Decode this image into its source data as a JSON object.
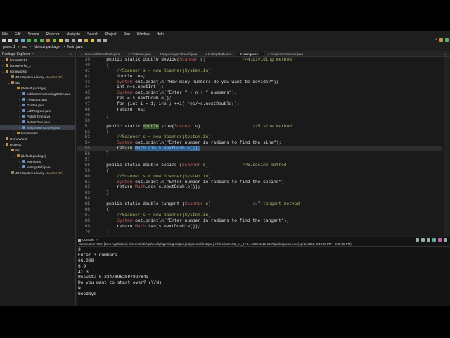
{
  "menu": [
    "File",
    "Edit",
    "Source",
    "Refactor",
    "Navigate",
    "Search",
    "Project",
    "Run",
    "Window",
    "Help"
  ],
  "breadcrumb": [
    "project1",
    "src",
    "(default package)",
    "Main.java"
  ],
  "package_explorer": {
    "title": "Package Explorer",
    "items": [
      {
        "label": "homeWork4",
        "depth": 0,
        "arrow": "›",
        "icon": "project"
      },
      {
        "label": "homeWork4_2",
        "depth": 0,
        "arrow": "›",
        "icon": "project"
      },
      {
        "label": "homework5",
        "depth": 0,
        "arrow": "⌄",
        "icon": "project"
      },
      {
        "label": "JRE System Library",
        "suffix": "[JavaSE-17]",
        "depth": 1,
        "arrow": "›",
        "icon": "library"
      },
      {
        "label": "src",
        "depth": 1,
        "arrow": "⌄",
        "icon": "folder"
      },
      {
        "label": "(default package)",
        "depth": 2,
        "arrow": "⌄",
        "icon": "package"
      },
      {
        "label": "bubleSortAscendingOrder.java",
        "depth": 3,
        "arrow": "›",
        "icon": "java"
      },
      {
        "label": "FirstLoop.java",
        "depth": 3,
        "arrow": "›",
        "icon": "java"
      },
      {
        "label": "Grades.java",
        "depth": 3,
        "arrow": "›",
        "icon": "java"
      },
      {
        "label": "LabProgram.java",
        "depth": 3,
        "arrow": "›",
        "icon": "java"
      },
      {
        "label": "PatternOne.java",
        "depth": 3,
        "arrow": "›",
        "icon": "java"
      },
      {
        "label": "PatternTwo.java",
        "depth": 3,
        "arrow": "›",
        "icon": "java"
      },
      {
        "label": "TelephoneNumber.java",
        "depth": 3,
        "arrow": "›",
        "icon": "java",
        "selected": true
      },
      {
        "label": "homework5",
        "depth": 2,
        "arrow": "›",
        "icon": "package"
      },
      {
        "label": "HomeWork6",
        "depth": 0,
        "arrow": "›",
        "icon": "project"
      },
      {
        "label": "project1",
        "depth": 0,
        "arrow": "⌄",
        "icon": "project"
      },
      {
        "label": "src",
        "depth": 1,
        "arrow": "⌄",
        "icon": "folder"
      },
      {
        "label": "(default package)",
        "depth": 2,
        "arrow": "⌄",
        "icon": "package"
      },
      {
        "label": "Main.java",
        "depth": 3,
        "arrow": "›",
        "icon": "java"
      },
      {
        "label": "testingMath.java",
        "depth": 3,
        "arrow": "›",
        "icon": "java"
      },
      {
        "label": "JRE System Library",
        "suffix": "[JavaSE-17]",
        "depth": 1,
        "arrow": "›",
        "icon": "library"
      }
    ]
  },
  "tabs": [
    {
      "label": "Homework6Methods.java"
    },
    {
      "label": "FirstLoop.java"
    },
    {
      "label": "CopenhagenTransit.java"
    },
    {
      "label": "testingMath.java"
    },
    {
      "label": "Main.java",
      "active": true
    },
    {
      "label": "TelephoneNumber.java"
    }
  ],
  "code": [
    {
      "n": "39",
      "t": [
        [
          "    public static double devide(",
          "kw"
        ],
        [
          "Scanner",
          "ty"
        ],
        [
          " s)              ",
          "kw"
        ],
        [
          "//4.dividing method",
          "cm"
        ]
      ]
    },
    {
      "n": "40",
      "t": [
        [
          "    {",
          "pl"
        ]
      ]
    },
    {
      "n": "41",
      "t": [
        [
          "        //Scanner s = new Scanner(System.in);",
          "cm"
        ]
      ]
    },
    {
      "n": "42",
      "t": [
        [
          "        double res;",
          "pl"
        ]
      ]
    },
    {
      "n": "43",
      "t": [
        [
          "        ",
          "pl"
        ],
        [
          "System",
          "ty"
        ],
        [
          ".out.println(\"How many numbers do you want to devide?\");",
          "pl"
        ]
      ]
    },
    {
      "n": "44",
      "t": [
        [
          "        int n=s.nextInt();",
          "pl"
        ]
      ]
    },
    {
      "n": "45",
      "t": [
        [
          "        ",
          "pl"
        ],
        [
          "System",
          "ty"
        ],
        [
          ".out.println(\"Enter \" + n + \" numbers\");",
          "pl"
        ]
      ]
    },
    {
      "n": "46",
      "t": [
        [
          "        res = s.nextDouble();",
          "pl"
        ]
      ]
    },
    {
      "n": "47",
      "t": [
        [
          "        for (int i = 1; i<n ; ++i) res/=s.nextDouble();",
          "pl"
        ]
      ]
    },
    {
      "n": "48",
      "t": [
        [
          "        return res;",
          "pl"
        ]
      ]
    },
    {
      "n": "49",
      "t": [
        [
          "    }",
          "pl"
        ]
      ]
    },
    {
      "n": "50",
      "t": []
    },
    {
      "n": "51",
      "t": [
        [
          "    public static ",
          "kw"
        ],
        [
          "double",
          "hl"
        ],
        [
          " sine(",
          "kw"
        ],
        [
          "Scanner",
          "ty"
        ],
        [
          " s)                    ",
          "kw"
        ],
        [
          "//5.sine method",
          "cm"
        ]
      ]
    },
    {
      "n": "52",
      "t": [
        [
          "    {",
          "pl"
        ]
      ]
    },
    {
      "n": "53",
      "t": [
        [
          "        //Scanner s = new Scanner(System.in);",
          "cm"
        ]
      ]
    },
    {
      "n": "54",
      "t": [
        [
          "        ",
          "pl"
        ],
        [
          "System",
          "ty"
        ],
        [
          ".out.println(\"Enter number in radians to find the sine\");",
          "pl"
        ]
      ]
    },
    {
      "n": "55",
      "cur": true,
      "t": [
        [
          "        return ",
          "pl"
        ],
        [
          "Math.sin(s.nextDouble());",
          "sel"
        ]
      ]
    },
    {
      "n": "56",
      "t": [
        [
          "    }",
          "pl"
        ]
      ]
    },
    {
      "n": "57",
      "t": []
    },
    {
      "n": "58",
      "t": [
        [
          "    public static double cosine (",
          "kw"
        ],
        [
          "Scanner",
          "ty"
        ],
        [
          " s)             ",
          "kw"
        ],
        [
          "//6.cosine method",
          "cm"
        ]
      ]
    },
    {
      "n": "59",
      "t": [
        [
          "    {",
          "pl"
        ]
      ]
    },
    {
      "n": "60",
      "t": [
        [
          "        //Scanner s = new Scanner(System.in);",
          "cm"
        ]
      ]
    },
    {
      "n": "61",
      "t": [
        [
          "        ",
          "pl"
        ],
        [
          "System",
          "ty"
        ],
        [
          ".out.println(\"Enter number in radians to find the cosine\");",
          "pl"
        ]
      ]
    },
    {
      "n": "62",
      "t": [
        [
          "        return ",
          "pl"
        ],
        [
          "Math",
          "ty"
        ],
        [
          ".cos(s.nextDouble());",
          "pl"
        ]
      ]
    },
    {
      "n": "63",
      "t": [
        [
          "    }",
          "pl"
        ]
      ]
    },
    {
      "n": "64",
      "t": []
    },
    {
      "n": "65",
      "t": [
        [
          "    public static double tangent (",
          "kw"
        ],
        [
          "Scanner",
          "ty"
        ],
        [
          " s)                ",
          "kw"
        ],
        [
          "//7.tangent method",
          "cm"
        ]
      ]
    },
    {
      "n": "66",
      "t": [
        [
          "    {",
          "pl"
        ]
      ]
    },
    {
      "n": "67",
      "t": [
        [
          "        //Scanner s = new Scanner(System.in);",
          "cm"
        ]
      ]
    },
    {
      "n": "68",
      "t": [
        [
          "        ",
          "pl"
        ],
        [
          "System",
          "ty"
        ],
        [
          ".out.println(\"Enter number in radians to find the tangent\");",
          "pl"
        ]
      ]
    },
    {
      "n": "69",
      "t": [
        [
          "        return ",
          "pl"
        ],
        [
          "Math",
          "ty"
        ],
        [
          ".tan(s.nextDouble());",
          "pl"
        ]
      ]
    },
    {
      "n": "70",
      "t": [
        [
          "    }",
          "pl"
        ]
      ]
    }
  ],
  "console": {
    "title": "Console",
    "terminated": "<terminated> Main [Java Application] C:\\Users\\jatid\\.p2\\pool\\plugins\\org.eclipse.justj.openjdk.hotspot.jre.full.win32.x86_64_17.0.1.v20211116-1657\\jre\\bin\\javaw.exe  (Apr 2, 2022, 3:42:59 PM – 3:45:05 PM)",
    "output": [
      "3",
      "Enter 3 numbers",
      "66.908",
      "6.9",
      "41.3",
      "Result: 0.23478962697827843",
      "Do you want to start over? (Y/N)",
      "N",
      "Goodbye"
    ]
  },
  "colors": {
    "project": "#c8914a",
    "library": "#9a8a6a",
    "folder": "#c8914a",
    "package": "#c08a3a",
    "java": "#6a8fc8"
  }
}
